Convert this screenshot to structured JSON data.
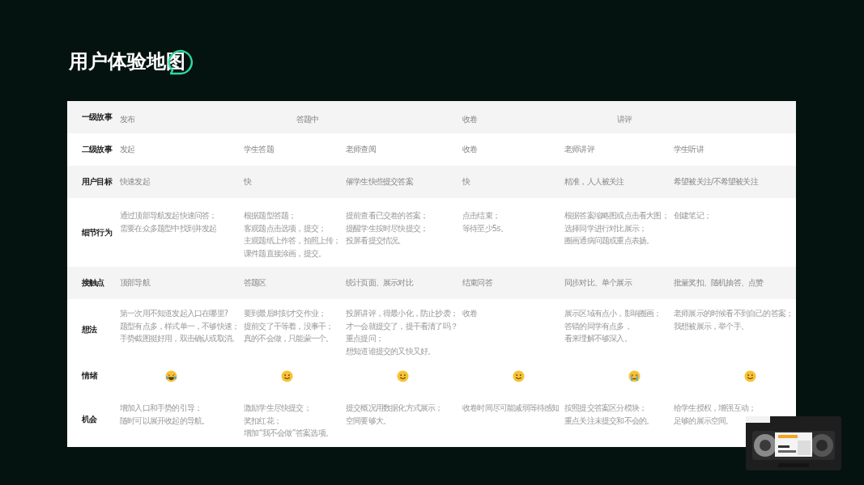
{
  "title": "用户体验地图",
  "map": {
    "rows": [
      {
        "label": "一级故事",
        "kind": "stories",
        "cells": [
          "发布",
          "答题中",
          "",
          "收卷",
          "讲评",
          ""
        ]
      },
      {
        "label": "二级故事",
        "kind": "text",
        "cells": [
          "发起",
          "学生答题",
          "老师查阅",
          "收卷",
          "老师讲评",
          "学生听讲"
        ]
      },
      {
        "label": "用户目标",
        "kind": "text",
        "cells": [
          "快速发起",
          "快",
          "催学生快些提交答案",
          "快",
          "精准，人人被关注",
          "希望被关注/不希望被关注"
        ]
      },
      {
        "label": "细节行为",
        "kind": "lines",
        "cells": [
          [
            "通过顶部导航发起快速问答；",
            "需要在众多题型中找到并发起"
          ],
          [
            "根据题型答题；",
            "客观题点击选项，提交；",
            "主观题纸上作答，拍照上传；",
            "课件题直接涂画，提交。"
          ],
          [
            "提前查看已交卷的答案；",
            "提醒学生按时尽快提交；",
            "投屏看提交情况。"
          ],
          [
            "点击结束；",
            "等待至少5s。"
          ],
          [
            "根据答案缩略图或点击看大图；",
            "选择同学进行对比展示；",
            "圈画通病问题或重点表扬。"
          ],
          [
            "创建笔记；"
          ]
        ]
      },
      {
        "label": "接触点",
        "kind": "text",
        "cells": [
          "顶部导航",
          "答题区",
          "统计页面、展示对比",
          "结束问答",
          "同步对比、单个展示",
          "批量奖扣、随机抽答、点赞"
        ]
      },
      {
        "label": "想法",
        "kind": "lines",
        "cells": [
          [
            "第一次用不知道发起入口在哪里?",
            "题型有点多，样式单一，不够快速；",
            "手势截图挺好用，双击确认或取消。"
          ],
          [
            "要到最后时刻才交作业；",
            "提前交了干等着，没事干；",
            "真的不会做，只能蒙一个。"
          ],
          [
            "投屏讲评，得最小化，防止抄袭；",
            "才一会就提交了，提干看清了吗？",
            "重点提问；",
            "想知道谁提交的又快又好。"
          ],
          [
            "收卷"
          ],
          [
            "展示区域有点小，影响圈画；",
            "答错的同学有点多，",
            "看来理解不够深入。"
          ],
          [
            "老师展示的时候看不到自己的答案；",
            "我想被展示，举个手。"
          ]
        ]
      },
      {
        "label": "情绪",
        "kind": "emotion",
        "cells": [
          {
            "kind": "laugh"
          },
          {
            "kind": "smile"
          },
          {
            "kind": "smile"
          },
          {
            "kind": "smile"
          },
          {
            "kind": "cry"
          },
          {
            "kind": "smile"
          }
        ]
      },
      {
        "label": "机会",
        "kind": "lines",
        "cells": [
          [
            "增加入口和手势的引导；",
            "随时可以展开收起的导航。"
          ],
          [
            "激励学生尽快提交；",
            "奖扣红花；",
            "增加“我不会做”答案选项。"
          ],
          [
            "提交概况用数据化方式展示；",
            "空间要够大。"
          ],
          [
            "收卷时间尽可能减弱等待感知"
          ],
          [
            "按照提交答案区分模块；",
            "重点关注未提交和不会的。"
          ],
          [
            "给学生授权，增强互动；",
            "足够的展示空间。"
          ]
        ]
      }
    ]
  }
}
